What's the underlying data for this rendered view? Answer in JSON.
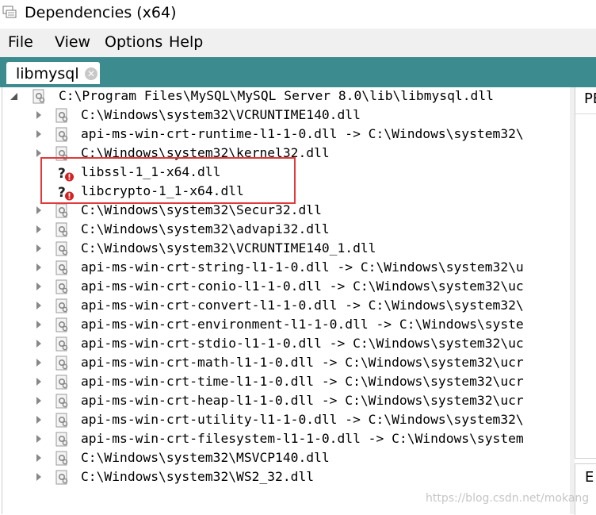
{
  "window": {
    "title": "Dependencies (x64)"
  },
  "menu": {
    "items": [
      "File",
      "View",
      "Options",
      "Help"
    ]
  },
  "tab": {
    "label": "libmysql"
  },
  "tree": {
    "root": "C:\\Program Files\\MySQL\\MySQL Server 8.0\\lib\\libmysql.dll",
    "children": [
      "C:\\Windows\\system32\\VCRUNTIME140.dll",
      "api-ms-win-crt-runtime-l1-1-0.dll -> C:\\Windows\\system32\\",
      "C:\\Windows\\system32\\kernel32.dll",
      "libssl-1_1-x64.dll",
      "libcrypto-1_1-x64.dll",
      "C:\\Windows\\system32\\Secur32.dll",
      "C:\\Windows\\system32\\advapi32.dll",
      "C:\\Windows\\system32\\VCRUNTIME140_1.dll",
      "api-ms-win-crt-string-l1-1-0.dll -> C:\\Windows\\system32\\u",
      "api-ms-win-crt-conio-l1-1-0.dll -> C:\\Windows\\system32\\uc",
      "api-ms-win-crt-convert-l1-1-0.dll -> C:\\Windows\\system32\\",
      "api-ms-win-crt-environment-l1-1-0.dll -> C:\\Windows\\syste",
      "api-ms-win-crt-stdio-l1-1-0.dll -> C:\\Windows\\system32\\uc",
      "api-ms-win-crt-math-l1-1-0.dll -> C:\\Windows\\system32\\ucr",
      "api-ms-win-crt-time-l1-1-0.dll -> C:\\Windows\\system32\\ucr",
      "api-ms-win-crt-heap-l1-1-0.dll -> C:\\Windows\\system32\\ucr",
      "api-ms-win-crt-utility-l1-1-0.dll -> C:\\Windows\\system32\\",
      "api-ms-win-crt-filesystem-l1-1-0.dll -> C:\\Windows\\system",
      "C:\\Windows\\system32\\MSVCP140.dll",
      "C:\\Windows\\system32\\WS2_32.dll"
    ]
  },
  "right_panel": {
    "top_label": "PE",
    "bottom_label": "E"
  },
  "watermark": "https://blog.csdn.net/mokang",
  "colors": {
    "tab_strip": "#3c8c8f",
    "highlight": "#e03a3a",
    "missing": "#d42020"
  },
  "icons": {
    "app": "dependencies-app-icon",
    "module": "dll-module-icon",
    "missing": "missing-module-icon"
  }
}
